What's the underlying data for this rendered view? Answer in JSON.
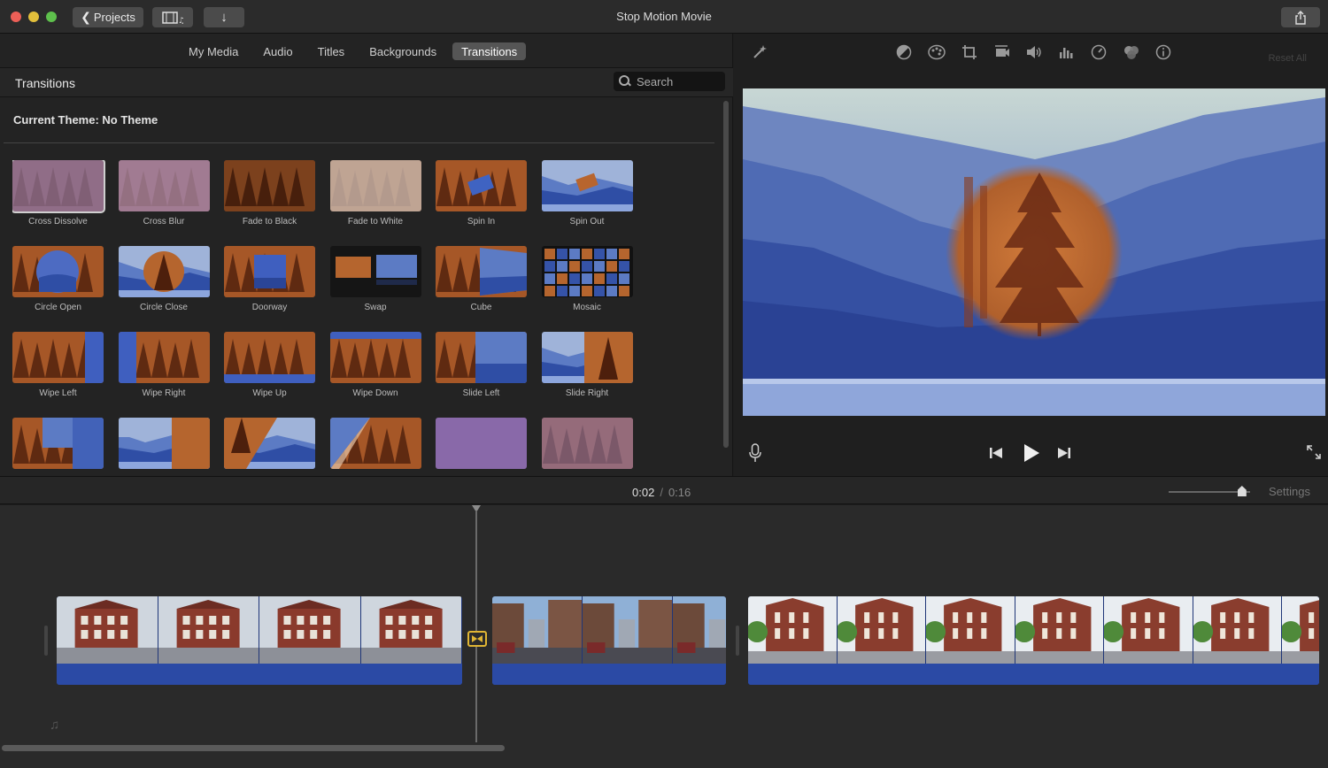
{
  "window": {
    "title": "Stop Motion Movie"
  },
  "toolbar": {
    "projects_label": "Projects"
  },
  "media_tabs": [
    {
      "label": "My Media",
      "active": false
    },
    {
      "label": "Audio",
      "active": false
    },
    {
      "label": "Titles",
      "active": false
    },
    {
      "label": "Backgrounds",
      "active": false
    },
    {
      "label": "Transitions",
      "active": true
    }
  ],
  "browser": {
    "section_title": "Transitions",
    "search_placeholder": "Search",
    "theme_label": "Current Theme: No Theme",
    "transitions": [
      {
        "label": "Cross Dissolve",
        "selected": true
      },
      {
        "label": "Cross Blur"
      },
      {
        "label": "Fade to Black"
      },
      {
        "label": "Fade to White"
      },
      {
        "label": "Spin In"
      },
      {
        "label": "Spin Out"
      },
      {
        "label": "Circle Open"
      },
      {
        "label": "Circle Close"
      },
      {
        "label": "Doorway"
      },
      {
        "label": "Swap"
      },
      {
        "label": "Cube"
      },
      {
        "label": "Mosaic"
      },
      {
        "label": "Wipe Left"
      },
      {
        "label": "Wipe Right"
      },
      {
        "label": "Wipe Up"
      },
      {
        "label": "Wipe Down"
      },
      {
        "label": "Slide Left"
      },
      {
        "label": "Slide Right"
      },
      {
        "label": ""
      },
      {
        "label": ""
      },
      {
        "label": ""
      },
      {
        "label": ""
      },
      {
        "label": ""
      },
      {
        "label": ""
      }
    ]
  },
  "viewer": {
    "reset_all": "Reset All",
    "tool_icons": [
      "magic-wand-icon",
      "color-balance-icon",
      "color-correction-icon",
      "crop-icon",
      "stabilization-icon",
      "volume-icon",
      "noise-reduction-icon",
      "speed-icon",
      "clip-filter-icon",
      "info-icon"
    ]
  },
  "timeline": {
    "current_time": "0:02",
    "separator": "/",
    "total_time": "0:16",
    "settings_label": "Settings",
    "zoom_level": 0.9
  },
  "colors": {
    "accent_transition": "#e0b534",
    "audio_track": "#2b4aa5",
    "active_tab": "#555555"
  }
}
